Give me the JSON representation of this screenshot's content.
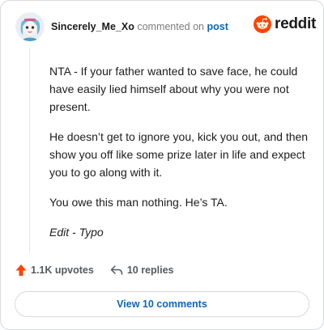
{
  "comment": {
    "author": "Sincerely_Me_Xo",
    "action_text": "commented on",
    "post_link": "post",
    "brand": "reddit",
    "paragraphs": [
      "NTA - If your father wanted to save face, he could have easily lied himself about why you were not present.",
      "He doesn’t get to ignore you, kick you out, and then show you off like some prize later in life and expect you to go along with it.",
      "You owe this man nothing. He’s TA.",
      "Edit - Typo"
    ]
  },
  "stats": {
    "upvotes": "1.1K upvotes",
    "replies": "10 replies"
  },
  "footer": {
    "view_comments": "View 10 comments"
  },
  "colors": {
    "accent": "#0a66c2",
    "upvote": "#ff4500",
    "reddit_orange": "#ff4500"
  },
  "icons": {
    "avatar": "avatar-icon",
    "logo": "reddit-logo-icon",
    "upvote": "upvote-arrow-icon",
    "reply": "reply-icon"
  }
}
